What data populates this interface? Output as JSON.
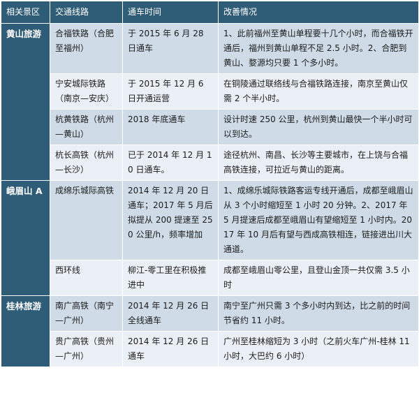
{
  "headers": [
    "相关景区",
    "交通线路",
    "通车时间",
    "改善情况"
  ],
  "groups": [
    {
      "region": "黄山旅游",
      "rows": [
        {
          "route": "合福铁路（合肥至福州）",
          "date": "于 2015 年 6 月 28 日通车",
          "improve": "1、此前福州至黄山单程要十几个小时，而合福铁开通后，福州到黄山单程不足 2.5 小时。2、合肥到黄山、婺源均只要 1 个多小时。"
        },
        {
          "route": "宁安城际铁路（南京—安庆）",
          "date": "于 2015 年 12 月 6 日开通运营",
          "improve": "在铜陵通过联络线与合福铁路连接，南京至黄山仅需 2 个半小时。"
        },
        {
          "route": "杭黄铁路（杭州—黄山）",
          "date": "2018 年底通车",
          "improve": "设计时速 250 公里，杭州到黄山最快一个半小时可以到达。"
        },
        {
          "route": "杭长高铁（杭州—长沙）",
          "date": "已于 2014 年 12 月 10 日通车。",
          "improve": "途径杭州、南昌、长沙等主要城市，在上饶与合福高铁连接，可拉近与黄山的距离。"
        }
      ]
    },
    {
      "region": "峨眉山 A",
      "rows": [
        {
          "route": "成绵乐城际高铁",
          "date": "2014 年 12 月 20 日通车；2017 年 5 月后拟提从 200 提速至 250 公里/h，频率增加",
          "improve": "1、成绵乐城际铁路客运专线开通后，成都至峨眉山从 3 个小时缩短至 1 小时 20 分钟。2、2017 年 5 月提速后成都至峨眉山有望缩短至 1 小时内。2017 年 10 月后有望与西成高铁相连，链接进出川大通道。"
        },
        {
          "route": "西环线",
          "date": "柳江-零工里在积极推进中",
          "improve": "成都至峨眉山零公里，且登山金顶一共仅需 3.5 小时"
        }
      ]
    },
    {
      "region": "桂林旅游",
      "rows": [
        {
          "route": "南广高铁（南宁—广州）",
          "date": "2014 年 12 月 26 日全线通车",
          "improve": "南宁至广州只需 3 个多小时内到达，比之前的时间节省约 11 小时。"
        },
        {
          "route": "贵广高铁（贵州—广州）",
          "date": "2014 年 12 月 26 日通车",
          "improve": "广州至桂林缩短为 3 小时（之前火车广州-桂林 11 小时，大巴约 6 小时）"
        }
      ]
    }
  ],
  "colors": {
    "header_bg": "#2f5c76",
    "row_dark": "#cfdce7",
    "row_light": "#eaf0f5"
  }
}
